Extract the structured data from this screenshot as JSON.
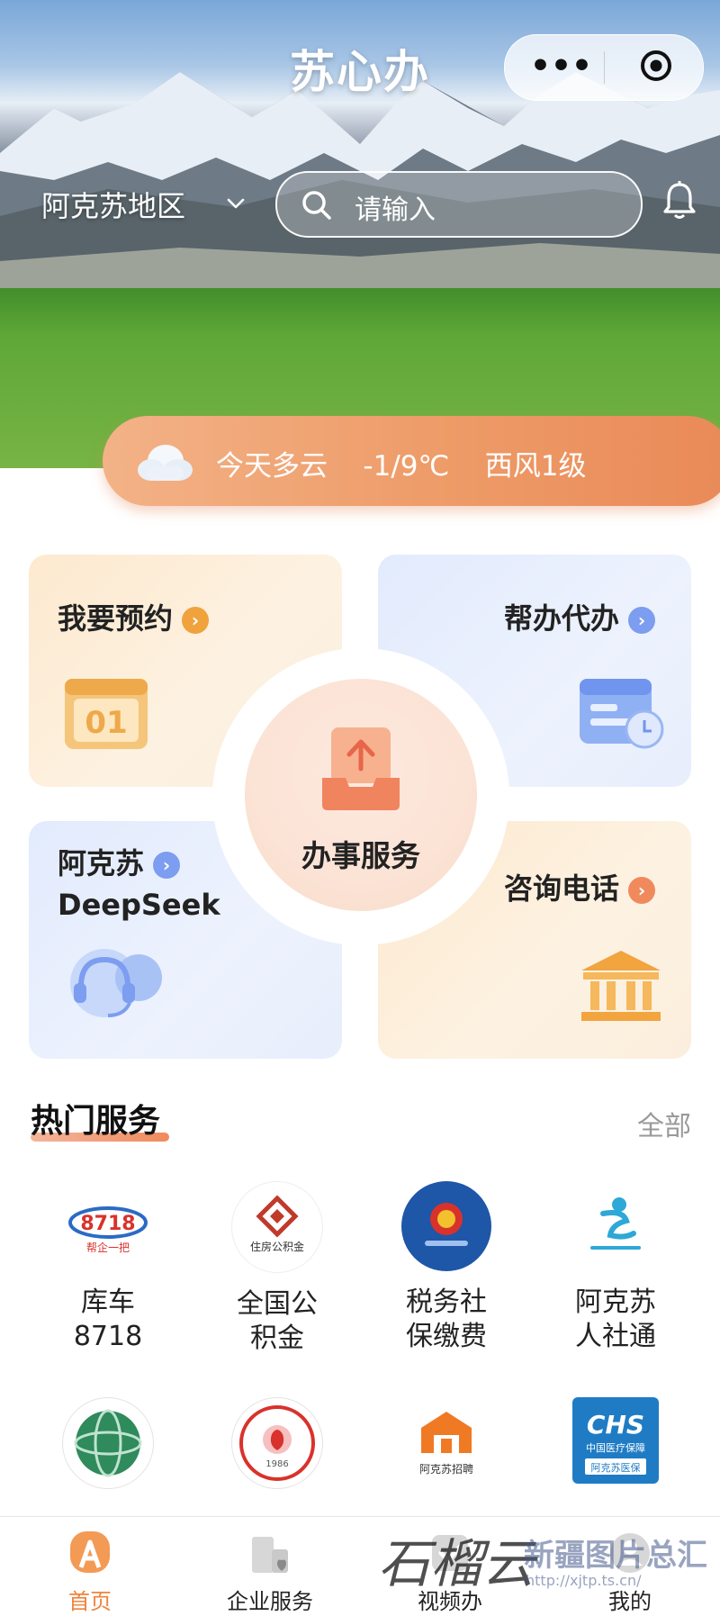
{
  "app": {
    "title": "苏心办"
  },
  "header": {
    "region": "阿克苏地区",
    "search_placeholder": "请输入",
    "icons": [
      "more-dots-icon",
      "target-icon",
      "chevron-down-icon",
      "search-icon",
      "bell-icon"
    ]
  },
  "weather": {
    "summary": "今天多云",
    "temperature": "-1/9℃",
    "wind": "西风1级",
    "icon": "cloud-icon"
  },
  "services_grid": {
    "center": "办事服务",
    "appointment": "我要预约",
    "agency": "帮办代办",
    "ai_line1": "阿克苏",
    "ai_line2": "DeepSeek",
    "hotline": "咨询电话",
    "calendar_number": "01"
  },
  "hot_services": {
    "title": "热门服务",
    "all_label": "全部",
    "items": [
      {
        "name": "库车\n8718",
        "logo_text": "8718",
        "logo_sub": "帮企一把"
      },
      {
        "name": "全国公\n积金",
        "logo_text": "住房公积金"
      },
      {
        "name": "税务社\n保缴费",
        "logo_text": ""
      },
      {
        "name": "阿克苏\n人社通",
        "logo_text": ""
      }
    ],
    "row2": [
      {
        "logo": "globe-logo"
      },
      {
        "logo": "emblem-logo",
        "logo_text": "1986"
      },
      {
        "logo": "recruit-logo",
        "logo_text": "阿克苏招聘"
      },
      {
        "logo": "chs-logo",
        "logo_text": "CHS",
        "logo_sub1": "中国医疗保障",
        "logo_sub2": "阿克苏医保"
      }
    ]
  },
  "tabbar": {
    "tabs": [
      {
        "label": "首页",
        "active": true
      },
      {
        "label": "企业服务",
        "active": false
      },
      {
        "label": "视频办",
        "active": false
      },
      {
        "label": "我的",
        "active": false
      }
    ]
  },
  "watermark": {
    "text1": "石榴云",
    "text2": "新疆图片总汇",
    "url": "http://xjtp.ts.cn/"
  },
  "colors": {
    "accent": "#f0833b",
    "weather_bar": "#ee9d6a",
    "blue_card": "#e2ebfd",
    "orange_card": "#fde9cf"
  }
}
